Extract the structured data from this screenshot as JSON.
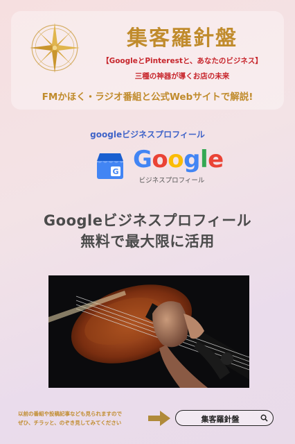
{
  "header": {
    "brand_title": "集客羅針盤",
    "subtitle_line1": "【GoogleとPinterestと、あなたのビジネス】",
    "subtitle_line2": "三種の神器が導くお店の未来",
    "headline": "FMかほく・ラジオ番組と公式Webサイトで解説!"
  },
  "google_section": {
    "label": "googleビジネスプロフィール",
    "logo_letters": [
      "G",
      "o",
      "o",
      "g",
      "l",
      "e"
    ],
    "logo_colors": [
      "#4285F4",
      "#EA4335",
      "#FBBC05",
      "#4285F4",
      "#34A853",
      "#EA4335"
    ],
    "logo_subtext": "ビジネスプロフィール"
  },
  "main": {
    "title_line1": "Googleビジネスプロフィール",
    "title_line2": "無料で最大限に活用"
  },
  "footer": {
    "note_line1": "以前の番組や投稿記事なども見られますので",
    "note_line2": "ぜひ、チラッと、のぞき見してみてください",
    "search_text": "集客羅針盤"
  },
  "colors": {
    "gold": "#c08b2c",
    "red": "#c7262c",
    "blue": "#3f63c8"
  },
  "icons": [
    "compass-rose-icon",
    "google-business-store-icon",
    "arrow-right-icon",
    "search-icon"
  ]
}
